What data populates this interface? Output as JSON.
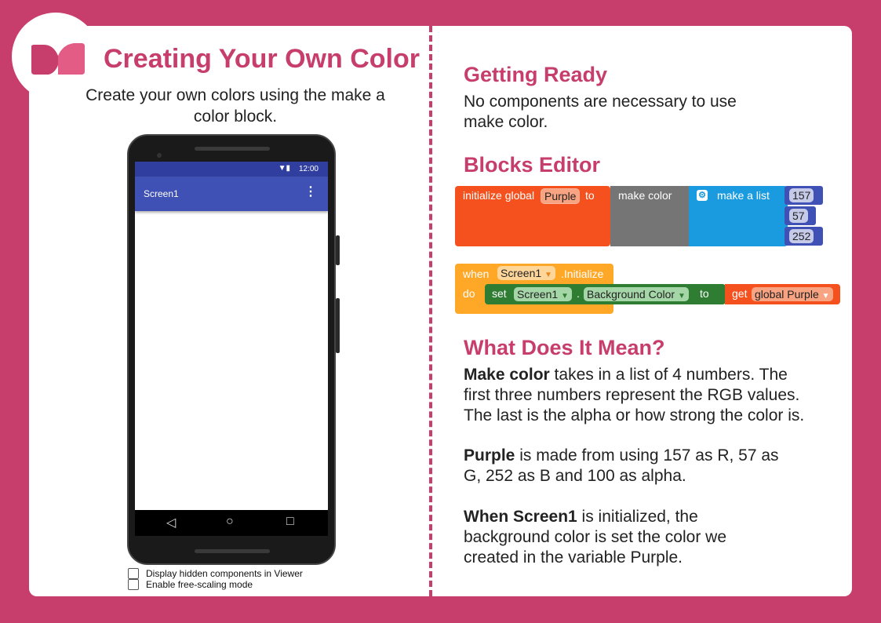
{
  "left": {
    "title": "Creating Your Own Color",
    "subtitle": "Create your own colors using the make a color block.",
    "phone": {
      "status_time": "12:00",
      "screen_title": "Screen1",
      "menu_icon": "more-vert-icon",
      "nav_back_icon": "◁",
      "nav_home_icon": "○",
      "nav_recent_icon": "□"
    },
    "checkboxes": [
      {
        "label": "Display hidden components in Viewer",
        "checked": false
      },
      {
        "label": "Enable free-scaling mode",
        "checked": false
      }
    ]
  },
  "right": {
    "getting_ready": {
      "heading": "Getting Ready",
      "text": "No components are necessary to use make color."
    },
    "blocks_editor": {
      "heading": "Blocks Editor",
      "block1": {
        "init_prefix": "initialize global",
        "var_name": "Purple",
        "init_to": "to",
        "make_color": "make color",
        "make_list": "make a list",
        "values": [
          "157",
          "57",
          "252"
        ]
      },
      "block2": {
        "when": "when",
        "component": "Screen1",
        "event": ".Initialize",
        "do": "do",
        "set": "set",
        "set_component": "Screen1",
        "dot": ".",
        "property": "Background Color",
        "to": "to",
        "get": "get",
        "get_var": "global Purple"
      }
    },
    "meaning": {
      "heading": "What Does It Mean?",
      "p1_bold": "Make color",
      "p1_rest": " takes in a list of 4 numbers. The first three numbers represent the RGB values. The last is the alpha or how strong the color is.",
      "p2_bold": "Purple",
      "p2_rest": " is made from using 157 as R, 57 as G, 252 as B and 100 as alpha.",
      "p3_bold": "When Screen1",
      "p3_rest": " is initialized, the background color is set the color we created in the variable Purple."
    }
  },
  "colors": {
    "accent": "#c73d6b",
    "init_block": "#f4511e",
    "make_color_block": "#757575",
    "list_block": "#1a9be0",
    "number_block": "#3f51b5",
    "event_block": "#ffa726",
    "set_block": "#2e7d32"
  }
}
